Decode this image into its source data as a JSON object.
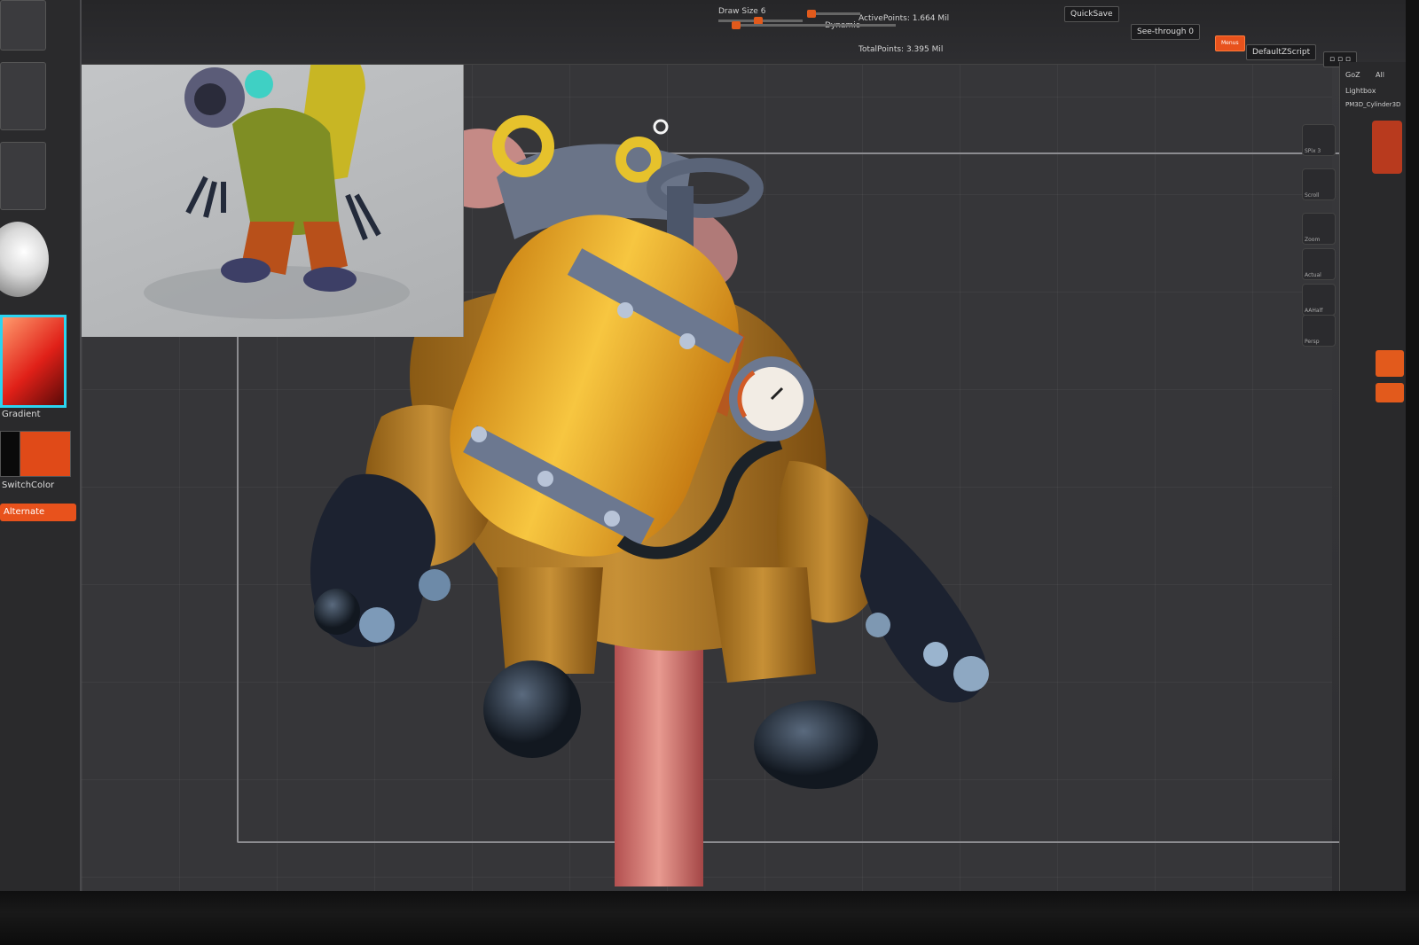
{
  "top": {
    "draw_size_label": "Draw Size 6",
    "dynamic_label": "Dynamic",
    "active_points": "ActivePoints: 1.664 Mil",
    "total_points": "TotalPoints: 3.395 Mil",
    "quicksave": "QuickSave",
    "see_through": "See-through 0",
    "default_zscript": "DefaultZScript",
    "menus_btn": "Menus"
  },
  "left": {
    "gradient_label": "Gradient",
    "switch_color_label": "SwitchColor",
    "alternate_label": "Alternate"
  },
  "right": {
    "goz": "GoZ",
    "all": "All",
    "lightbox": "Lightbox",
    "tool_name": "PM3D_Cylinder3D",
    "shelf": [
      "SPix 3",
      "Scroll",
      "Zoom",
      "Actual",
      "AAHalf",
      "Persp"
    ]
  },
  "colors": {
    "accent": "#e8521c",
    "primary_color": "#e04a18",
    "secondary_color": "#0a0a0a"
  }
}
